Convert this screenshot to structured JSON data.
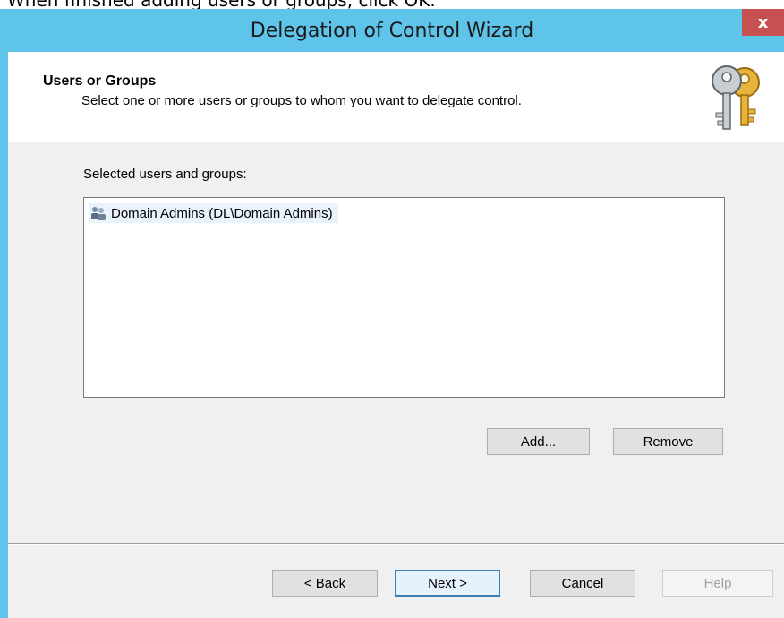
{
  "doc_text": "When finished adding users or groups, click OK.",
  "window": {
    "title": "Delegation of Control Wizard",
    "close_glyph": "x"
  },
  "header": {
    "title": "Users or Groups",
    "subtitle": "Select one or more users or groups to whom you want to delegate control.",
    "icon": "keys-icon"
  },
  "list": {
    "label": "Selected users and groups:",
    "items": [
      {
        "text": "Domain Admins (DL\\Domain Admins)",
        "icon": "group-icon",
        "selected": true
      }
    ]
  },
  "buttons": {
    "add": "Add...",
    "remove": "Remove",
    "back": "< Back",
    "next": "Next >",
    "cancel": "Cancel",
    "help": "Help"
  },
  "colors": {
    "titlebar": "#5fc4ea",
    "close": "#c75050",
    "dialog": "#f0f0f0"
  }
}
